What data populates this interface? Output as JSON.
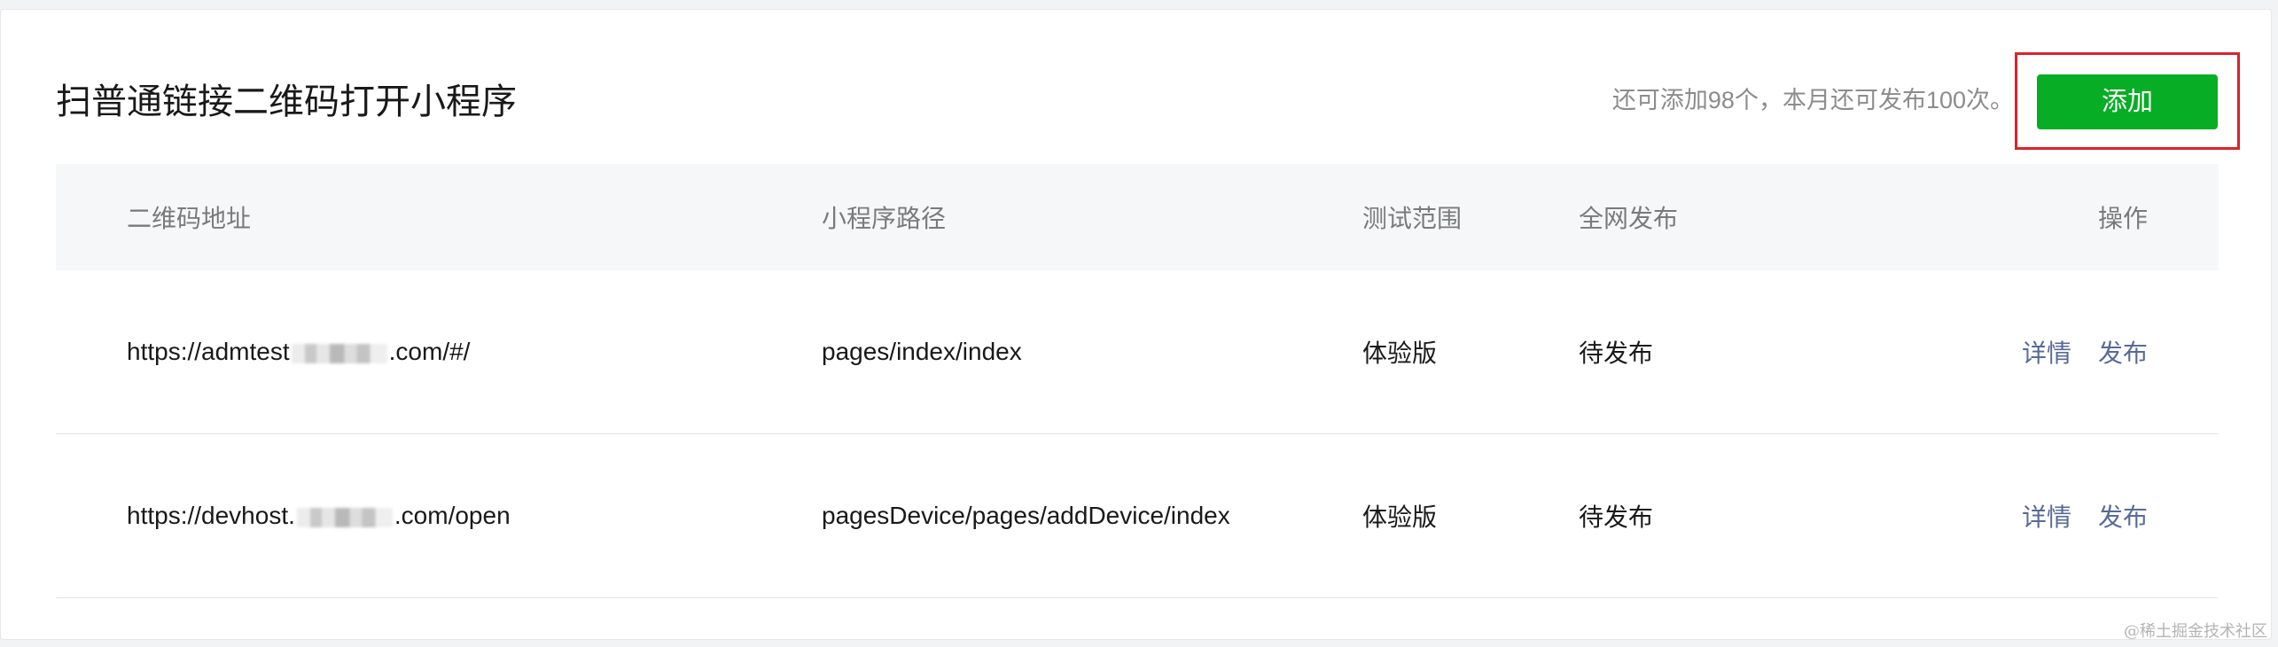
{
  "panel": {
    "title": "扫普通链接二维码打开小程序",
    "quota_text": "还可添加98个，本月还可发布100次。",
    "add_button_label": "添加"
  },
  "table": {
    "headers": {
      "url": "二维码地址",
      "path": "小程序路径",
      "test_scope": "测试范围",
      "publish": "全网发布",
      "actions": "操作"
    },
    "rows": [
      {
        "url_prefix": "https://admtest",
        "url_suffix": ".com/#/",
        "path": "pages/index/index",
        "test_scope": "体验版",
        "publish_status": "待发布",
        "detail_label": "详情",
        "publish_label": "发布"
      },
      {
        "url_prefix": "https://devhost.",
        "url_suffix": ".com/open",
        "path": "pagesDevice/pages/addDevice/index",
        "test_scope": "体验版",
        "publish_status": "待发布",
        "detail_label": "详情",
        "publish_label": "发布"
      }
    ]
  },
  "watermark": "@稀土掘金技术社区",
  "colors": {
    "accent_green": "#07ad24",
    "link_blue": "#576b95",
    "highlight_red": "#d9232c"
  }
}
